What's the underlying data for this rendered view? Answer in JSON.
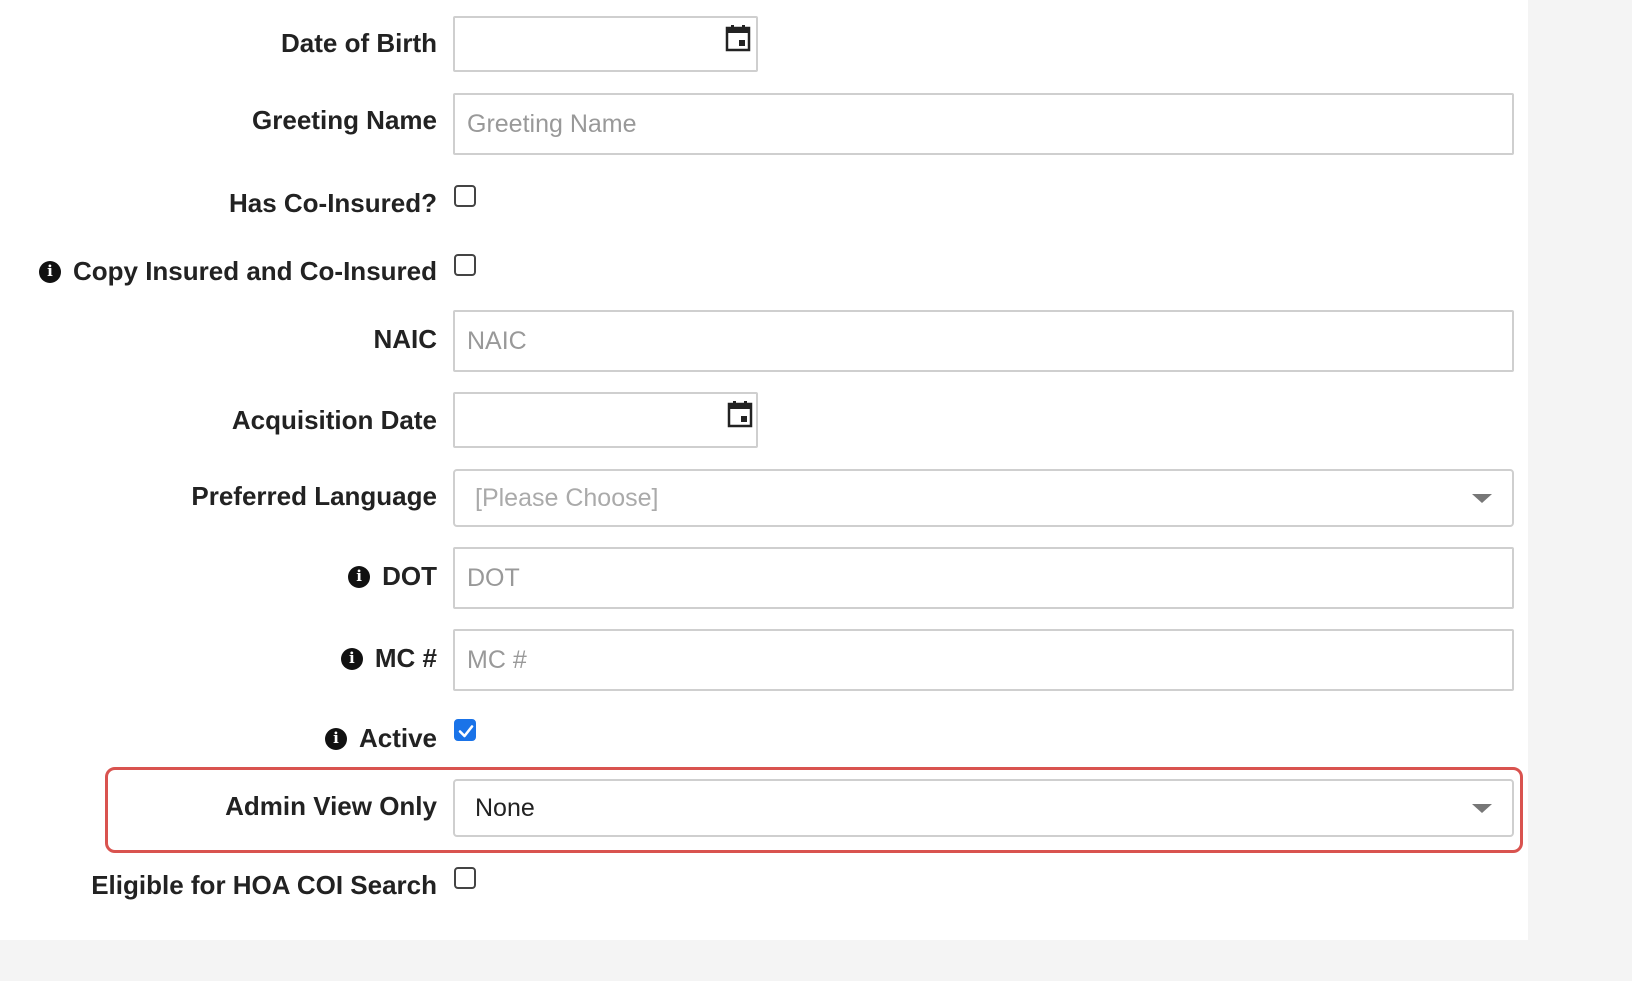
{
  "form": {
    "date_of_birth": {
      "label": "Date of Birth",
      "value": ""
    },
    "greeting_name": {
      "label": "Greeting Name",
      "placeholder": "Greeting Name"
    },
    "has_co_insured": {
      "label": "Has Co-Insured?",
      "checked": false
    },
    "copy_insured": {
      "label": "Copy Insured and Co-Insured",
      "checked": false,
      "info_icon": "info-circle-icon"
    },
    "naic": {
      "label": "NAIC",
      "placeholder": "NAIC"
    },
    "acquisition_date": {
      "label": "Acquisition Date",
      "value": ""
    },
    "preferred_language": {
      "label": "Preferred Language",
      "selected": "[Please Choose]"
    },
    "dot": {
      "label": "DOT",
      "placeholder": "DOT",
      "info_icon": "info-circle-icon"
    },
    "mc_number": {
      "label": "MC #",
      "placeholder": "MC #",
      "info_icon": "info-circle-icon"
    },
    "active": {
      "label": "Active",
      "checked": true,
      "info_icon": "info-circle-icon"
    },
    "admin_view_only": {
      "label": "Admin View Only",
      "selected": "None",
      "highlighted": true
    },
    "eligible_hoa": {
      "label": "Eligible for HOA COI Search",
      "checked": false
    }
  },
  "colors": {
    "highlight_border": "#d9534f",
    "checkbox_checked": "#1a73e8",
    "input_border": "#cfcfcf"
  },
  "icons": {
    "calendar": "calendar-icon",
    "dropdown": "chevron-down-icon",
    "info": "info-circle-icon"
  }
}
